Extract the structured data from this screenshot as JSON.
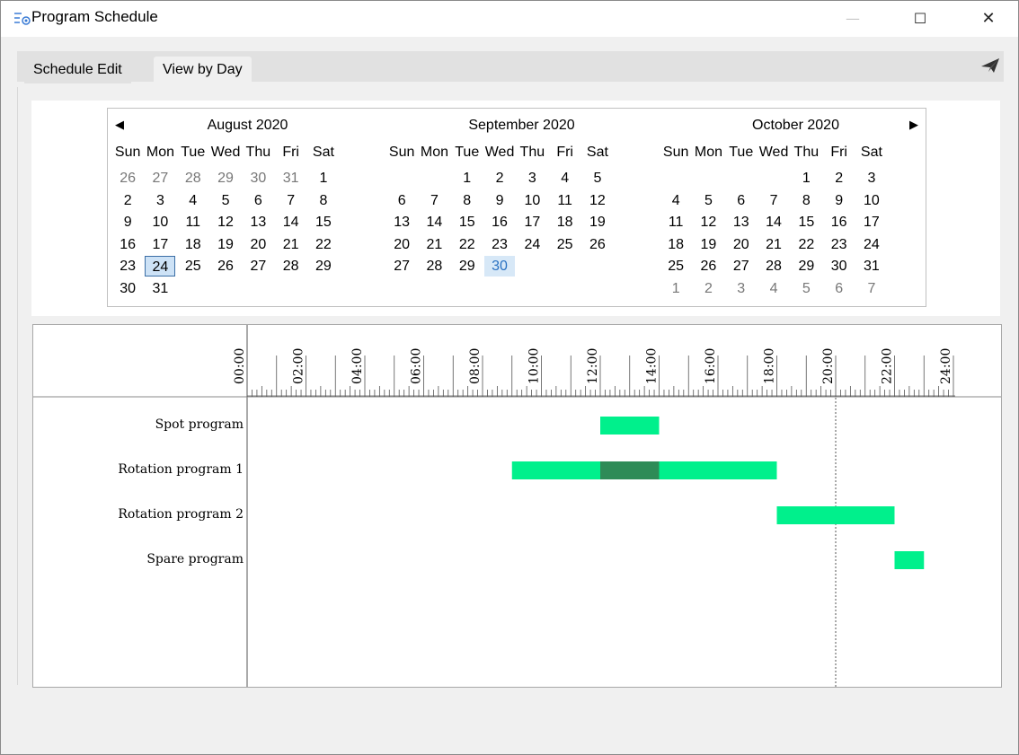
{
  "window": {
    "title": "Program Schedule",
    "minimize_glyph": "—",
    "maximize_glyph": "☐",
    "close_glyph": "✕"
  },
  "tabs": [
    {
      "label": "Schedule Edit",
      "active": false
    },
    {
      "label": "View by Day",
      "active": true
    }
  ],
  "toolbar": {
    "send_icon": "paper-plane-icon"
  },
  "calendar": {
    "prev_arrow": "◀",
    "next_arrow": "▶",
    "weekdays": [
      "Sun",
      "Mon",
      "Tue",
      "Wed",
      "Thu",
      "Fri",
      "Sat"
    ],
    "months": [
      {
        "title": "August 2020",
        "weeks": [
          [
            {
              "d": "26",
              "o": true
            },
            {
              "d": "27",
              "o": true
            },
            {
              "d": "28",
              "o": true
            },
            {
              "d": "29",
              "o": true
            },
            {
              "d": "30",
              "o": true
            },
            {
              "d": "31",
              "o": true
            },
            {
              "d": "1"
            }
          ],
          [
            {
              "d": "2"
            },
            {
              "d": "3"
            },
            {
              "d": "4"
            },
            {
              "d": "5"
            },
            {
              "d": "6"
            },
            {
              "d": "7"
            },
            {
              "d": "8"
            }
          ],
          [
            {
              "d": "9"
            },
            {
              "d": "10"
            },
            {
              "d": "11"
            },
            {
              "d": "12"
            },
            {
              "d": "13"
            },
            {
              "d": "14"
            },
            {
              "d": "15"
            }
          ],
          [
            {
              "d": "16"
            },
            {
              "d": "17"
            },
            {
              "d": "18"
            },
            {
              "d": "19"
            },
            {
              "d": "20"
            },
            {
              "d": "21"
            },
            {
              "d": "22"
            }
          ],
          [
            {
              "d": "23"
            },
            {
              "d": "24",
              "selected": true
            },
            {
              "d": "25"
            },
            {
              "d": "26"
            },
            {
              "d": "27"
            },
            {
              "d": "28"
            },
            {
              "d": "29"
            }
          ],
          [
            {
              "d": "30"
            },
            {
              "d": "31"
            },
            {
              "d": ""
            },
            {
              "d": ""
            },
            {
              "d": ""
            },
            {
              "d": ""
            },
            {
              "d": ""
            }
          ]
        ]
      },
      {
        "title": "September 2020",
        "weeks": [
          [
            {
              "d": ""
            },
            {
              "d": ""
            },
            {
              "d": "1"
            },
            {
              "d": "2"
            },
            {
              "d": "3"
            },
            {
              "d": "4"
            },
            {
              "d": "5"
            }
          ],
          [
            {
              "d": "6"
            },
            {
              "d": "7"
            },
            {
              "d": "8"
            },
            {
              "d": "9"
            },
            {
              "d": "10"
            },
            {
              "d": "11"
            },
            {
              "d": "12"
            }
          ],
          [
            {
              "d": "13"
            },
            {
              "d": "14"
            },
            {
              "d": "15"
            },
            {
              "d": "16"
            },
            {
              "d": "17"
            },
            {
              "d": "18"
            },
            {
              "d": "19"
            }
          ],
          [
            {
              "d": "20"
            },
            {
              "d": "21"
            },
            {
              "d": "22"
            },
            {
              "d": "23"
            },
            {
              "d": "24"
            },
            {
              "d": "25"
            },
            {
              "d": "26"
            }
          ],
          [
            {
              "d": "27"
            },
            {
              "d": "28"
            },
            {
              "d": "29"
            },
            {
              "d": "30",
              "today": true
            },
            {
              "d": ""
            },
            {
              "d": ""
            },
            {
              "d": ""
            }
          ],
          [
            {
              "d": ""
            },
            {
              "d": ""
            },
            {
              "d": ""
            },
            {
              "d": ""
            },
            {
              "d": ""
            },
            {
              "d": ""
            },
            {
              "d": ""
            }
          ]
        ]
      },
      {
        "title": "October 2020",
        "weeks": [
          [
            {
              "d": ""
            },
            {
              "d": ""
            },
            {
              "d": ""
            },
            {
              "d": ""
            },
            {
              "d": "1"
            },
            {
              "d": "2"
            },
            {
              "d": "3"
            }
          ],
          [
            {
              "d": "4"
            },
            {
              "d": "5"
            },
            {
              "d": "6"
            },
            {
              "d": "7"
            },
            {
              "d": "8"
            },
            {
              "d": "9"
            },
            {
              "d": "10"
            }
          ],
          [
            {
              "d": "11"
            },
            {
              "d": "12"
            },
            {
              "d": "13"
            },
            {
              "d": "14"
            },
            {
              "d": "15"
            },
            {
              "d": "16"
            },
            {
              "d": "17"
            }
          ],
          [
            {
              "d": "18"
            },
            {
              "d": "19"
            },
            {
              "d": "20"
            },
            {
              "d": "21"
            },
            {
              "d": "22"
            },
            {
              "d": "23"
            },
            {
              "d": "24"
            }
          ],
          [
            {
              "d": "25"
            },
            {
              "d": "26"
            },
            {
              "d": "27"
            },
            {
              "d": "28"
            },
            {
              "d": "29"
            },
            {
              "d": "30"
            },
            {
              "d": "31"
            }
          ],
          [
            {
              "d": "1",
              "o": true
            },
            {
              "d": "2",
              "o": true
            },
            {
              "d": "3",
              "o": true
            },
            {
              "d": "4",
              "o": true
            },
            {
              "d": "5",
              "o": true
            },
            {
              "d": "6",
              "o": true
            },
            {
              "d": "7",
              "o": true
            }
          ]
        ]
      }
    ]
  },
  "timeline": {
    "hour_labels": [
      "00:00",
      "02:00",
      "04:00",
      "06:00",
      "08:00",
      "10:00",
      "12:00",
      "14:00",
      "16:00",
      "18:00",
      "20:00",
      "22:00",
      "24:00"
    ],
    "marker_hour": 20,
    "colors": {
      "bar": "#00f08c",
      "overlap": "#2e8b57",
      "marker": "#555555"
    },
    "rows": [
      {
        "name": "Spot program",
        "bars": [
          {
            "start": 12,
            "end": 14
          }
        ],
        "overlaps": []
      },
      {
        "name": "Rotation program 1",
        "bars": [
          {
            "start": 9,
            "end": 18
          }
        ],
        "overlaps": [
          {
            "start": 12,
            "end": 14
          }
        ]
      },
      {
        "name": "Rotation program 2",
        "bars": [
          {
            "start": 18,
            "end": 22
          }
        ],
        "overlaps": []
      },
      {
        "name": "Spare program",
        "bars": [
          {
            "start": 22,
            "end": 23
          }
        ],
        "overlaps": []
      }
    ]
  }
}
